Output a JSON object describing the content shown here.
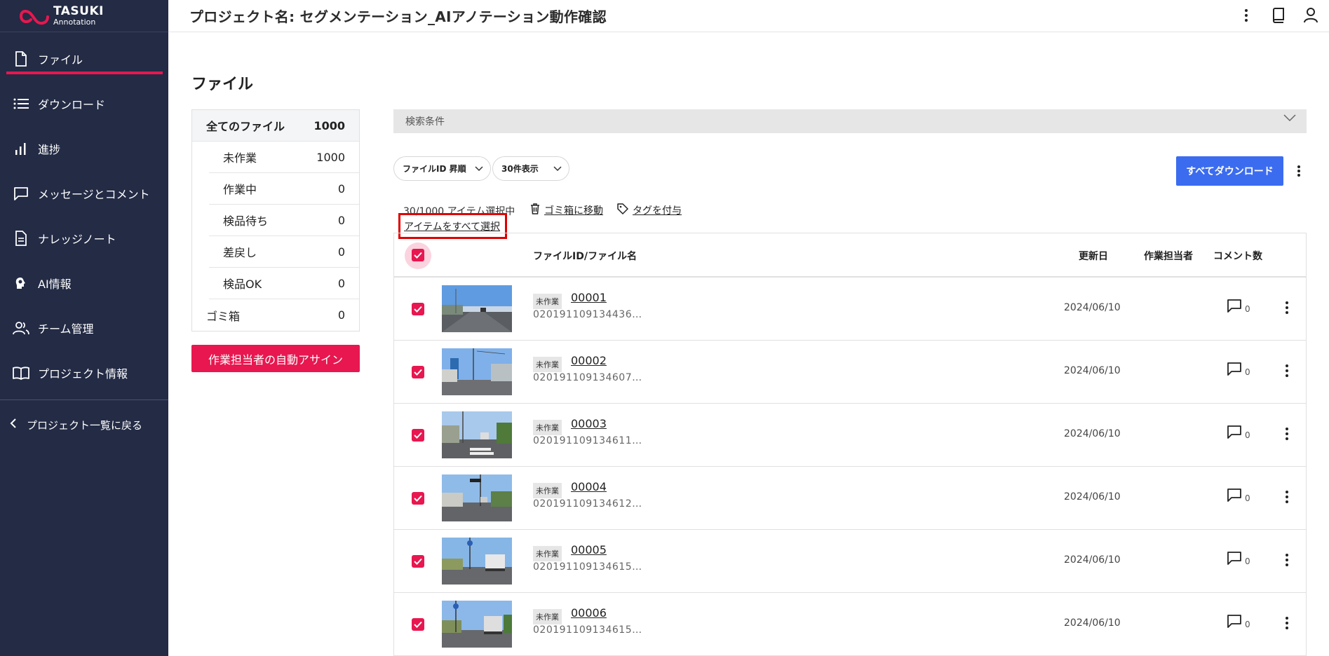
{
  "logo": {
    "line1": "TASUKI",
    "line2": "Annotation"
  },
  "sidebar": {
    "items": [
      {
        "label": "ファイル",
        "icon": "file-icon"
      },
      {
        "label": "ダウンロード",
        "icon": "list-icon"
      },
      {
        "label": "進捗",
        "icon": "bar-chart-icon"
      },
      {
        "label": "メッセージとコメント",
        "icon": "chat-icon"
      },
      {
        "label": "ナレッジノート",
        "icon": "document-icon"
      },
      {
        "label": "AI情報",
        "icon": "ai-head-icon"
      },
      {
        "label": "チーム管理",
        "icon": "team-icon"
      },
      {
        "label": "プロジェクト情報",
        "icon": "book-icon"
      }
    ],
    "back_label": "プロジェクト一覧に戻る"
  },
  "header": {
    "title": "プロジェクト名: セグメンテーション_AIアノテーション動作確認"
  },
  "page": {
    "title": "ファイル"
  },
  "filter_panel": {
    "all": {
      "label": "全てのファイル",
      "count": "1000"
    },
    "statuses": [
      {
        "label": "未作業",
        "count": "1000"
      },
      {
        "label": "作業中",
        "count": "0"
      },
      {
        "label": "検品待ち",
        "count": "0"
      },
      {
        "label": "差戻し",
        "count": "0"
      },
      {
        "label": "検品OK",
        "count": "0"
      }
    ],
    "trash": {
      "label": "ゴミ箱",
      "count": "0"
    },
    "assign_button": "作業担当者の自動アサイン"
  },
  "search": {
    "label": "検索条件"
  },
  "sort_dropdown": "ファイルID 昇順",
  "per_page_dropdown": "30件表示",
  "download_all_button": "すべてダウンロード",
  "selection": {
    "count_text": "30/1000 アイテム選択中",
    "move_to_trash": "ゴミ箱に移動",
    "add_tag": "タグを付与",
    "select_all": "アイテムをすべて選択"
  },
  "table": {
    "headers": {
      "file": "ファイルID/ファイル名",
      "updated": "更新日",
      "assignee": "作業担当者",
      "comments": "コメント数"
    },
    "rows": [
      {
        "status": "未作業",
        "id": "00001",
        "name": "020191109134436…",
        "date": "2024/06/10",
        "comments": "0"
      },
      {
        "status": "未作業",
        "id": "00002",
        "name": "020191109134607…",
        "date": "2024/06/10",
        "comments": "0"
      },
      {
        "status": "未作業",
        "id": "00003",
        "name": "020191109134611…",
        "date": "2024/06/10",
        "comments": "0"
      },
      {
        "status": "未作業",
        "id": "00004",
        "name": "020191109134612…",
        "date": "2024/06/10",
        "comments": "0"
      },
      {
        "status": "未作業",
        "id": "00005",
        "name": "020191109134615…",
        "date": "2024/06/10",
        "comments": "0"
      },
      {
        "status": "未作業",
        "id": "00006",
        "name": "020191109134615…",
        "date": "2024/06/10",
        "comments": "0"
      }
    ]
  },
  "colors": {
    "sidebar_bg": "#232b45",
    "accent": "#e8174f",
    "primary": "#3b6cf0",
    "highlight": "#e00000"
  }
}
